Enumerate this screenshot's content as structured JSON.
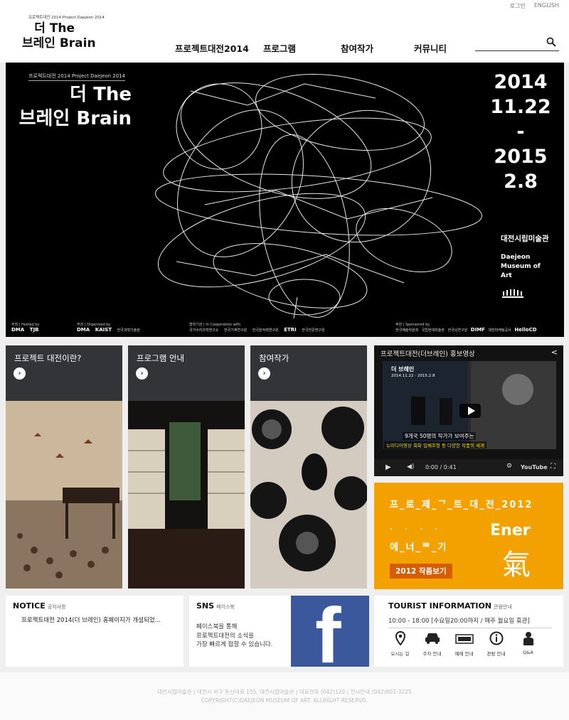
{
  "util": {
    "login": "로그인",
    "english": "ENGLISH"
  },
  "logo": {
    "small": "프로젝트대전 2014   Project Daejeon 2014",
    "title_line1": "더 The",
    "title_line2": "브레인 Brain"
  },
  "nav": [
    "프로젝트대전2014",
    "프로그램",
    "참여작가",
    "커뮤니티"
  ],
  "search": {
    "placeholder": ""
  },
  "hero": {
    "small": "프로젝트대전 2014   Project Daejeon 2014",
    "title_line1": "더 The",
    "title_line2": "브레인 Brain",
    "date_start_year": "2014",
    "date_start_md": "11.22",
    "date_dash": "-",
    "date_end_year": "2015",
    "date_end_md": "2.8",
    "venue_ko": "대전시립미술관",
    "venue_en": [
      "Daejeon",
      "Museum of",
      "Art"
    ],
    "hosted_label": "주최 | Hosted by",
    "organised_label": "주관 | Organised by",
    "cooperation_label": "협력기관 | In Cooperation with",
    "sponsor_label": "후원 | Sponsored by",
    "hosted_logos": [
      "DMA",
      "TJB"
    ],
    "organised_logos": [
      "DMA",
      "KAIST",
      "한국과학기술원"
    ],
    "coop_logos": [
      "국가수리과학연구소",
      "한국기계연구원",
      "한국원자력연구원",
      "ETRI",
      "한국천문연구원"
    ],
    "sponsor_logos": [
      "한국예술위원회",
      "국립현대미술관",
      "한국뇌연구원",
      "DIMF",
      "대전마케팅공사",
      "HelloCD"
    ]
  },
  "cards": [
    {
      "label": "프로젝트 대전이란?"
    },
    {
      "label": "프로그램 안내"
    },
    {
      "label": "참여작가"
    }
  ],
  "video": {
    "title": "프로젝트대전(더브레인) 홍보영상",
    "time": "0:00 / 0:41",
    "brand": "YouTube",
    "caption1": "9개국 50명의 작가가 보여주는",
    "caption2": "뉴미디어영상 회화 입체조형 등 다양한 작품의 세계",
    "screen_title": "더 브레인",
    "screen_date": "2014.11.22 - 2015.2.8"
  },
  "orange": {
    "line1": "프_로_제_ᄀ_트_대_전_2012",
    "line2": "· · · ·",
    "line3": "에_너_ᄅ_기",
    "ener": "Ener",
    "chi": "氣",
    "button": "2012 작품보기"
  },
  "notice": {
    "title": "NOTICE",
    "sub": "공지사항",
    "item": "프로젝트대전 2014(더 브레인) 홈페이지가 개설되었..."
  },
  "sns": {
    "title": "SNS",
    "sub": "페이스북",
    "text": [
      "페이스북을 통해",
      "프로젝트대전의 소식을",
      "가장 빠르게 접할 수 있습니다."
    ],
    "fb": "f"
  },
  "tourist": {
    "title": "TOURIST INFORMATION",
    "sub": "관람안내",
    "hours": "10:00 - 18:00 [수요일20:00까지 / 매주 월요일 휴관]",
    "icons": [
      {
        "icon": "location-pin-icon",
        "label": "오시는 길"
      },
      {
        "icon": "car-icon",
        "label": "주차 안내"
      },
      {
        "icon": "ticket-icon",
        "label": "예매 안내"
      },
      {
        "icon": "info-icon",
        "label": "관람 안내"
      },
      {
        "icon": "person-icon",
        "label": "Q&A"
      }
    ]
  },
  "footer": {
    "line1": "대전시립미술관 | 대전시 서구 둔산대로 155, 대전시립미술관 | 대표전화 (042)120 | 전시안내 (042)602-3225",
    "line2": "COPYRIGHT(C)DAEJEON MUSEUM OF ART. ALLRIGHT RESERVD."
  }
}
